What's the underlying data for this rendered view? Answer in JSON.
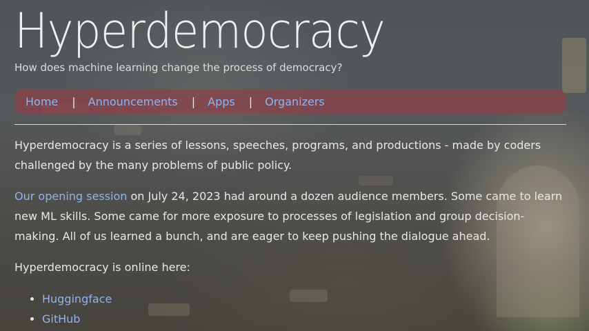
{
  "site": {
    "title": "Hyperdemocracy",
    "tagline": "How does machine learning change the process of democracy?"
  },
  "nav": {
    "items": [
      "Home",
      "Announcements",
      "Apps",
      "Organizers"
    ],
    "separator": "|"
  },
  "content": {
    "intro": "Hyperdemocracy is a series of lessons, speeches, programs, and productions - made by coders challenged by the many problems of public policy.",
    "session_link": "Our opening session",
    "session_text": " on July 24, 2023 had around a dozen audience members. Some came to learn new ML skills. Some came for more exposure to processes of legislation and group decision-making. All of us learned a bunch, and are eager to keep pushing the dialogue ahead.",
    "online_heading": "Hyperdemocracy is online here:",
    "online_links": [
      "Huggingface",
      "GitHub"
    ]
  },
  "colors": {
    "link": "#8fb3f0",
    "nav_background": "#963c46"
  }
}
